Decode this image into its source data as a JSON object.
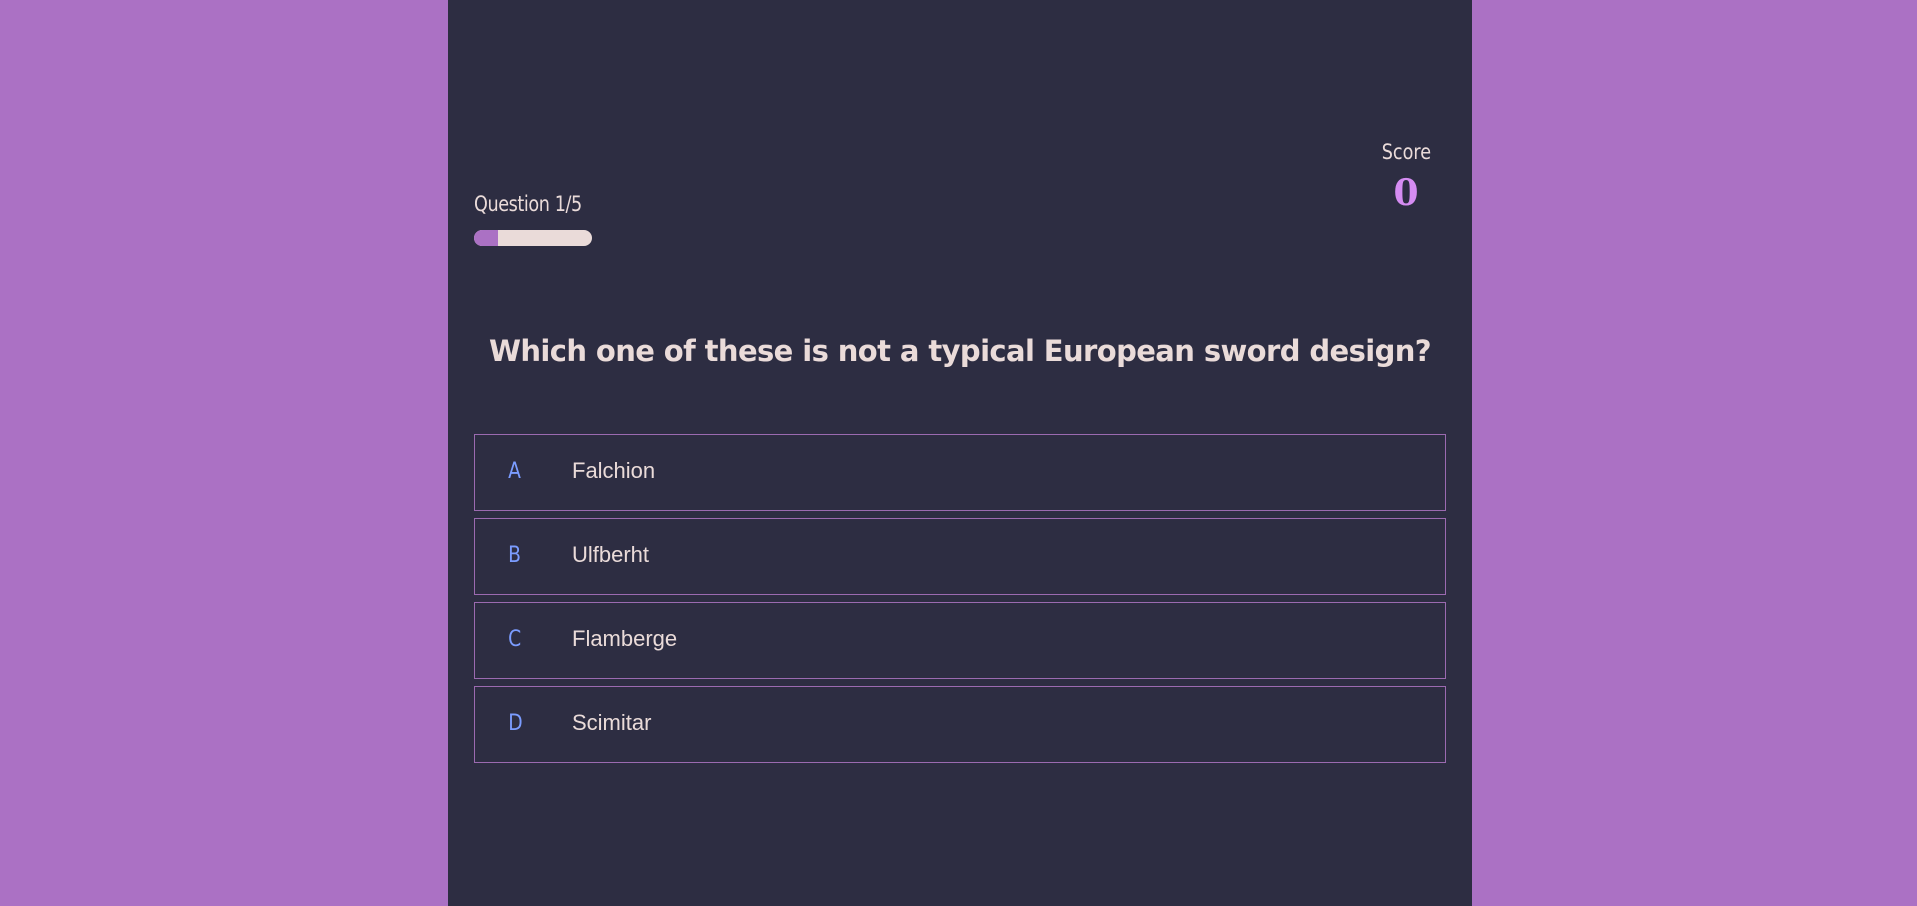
{
  "hud": {
    "progress_text": "Question 1/5",
    "progress_fraction": 0.2,
    "score_label": "Score",
    "score_value": "0"
  },
  "question": "Which one of these is not a typical European sword design?",
  "choices": [
    {
      "prefix": "A",
      "text": "Falchion"
    },
    {
      "prefix": "B",
      "text": "Ulfberht"
    },
    {
      "prefix": "C",
      "text": "Flamberge"
    },
    {
      "prefix": "D",
      "text": "Scimitar"
    }
  ],
  "colors": {
    "page_background": "#ab71c4",
    "panel_background": "#2d2d42",
    "text": "#eadbd9",
    "score_accent": "#d58cf2",
    "choice_prefix": "#7b9cff",
    "choice_border": "#9b6ab0"
  }
}
